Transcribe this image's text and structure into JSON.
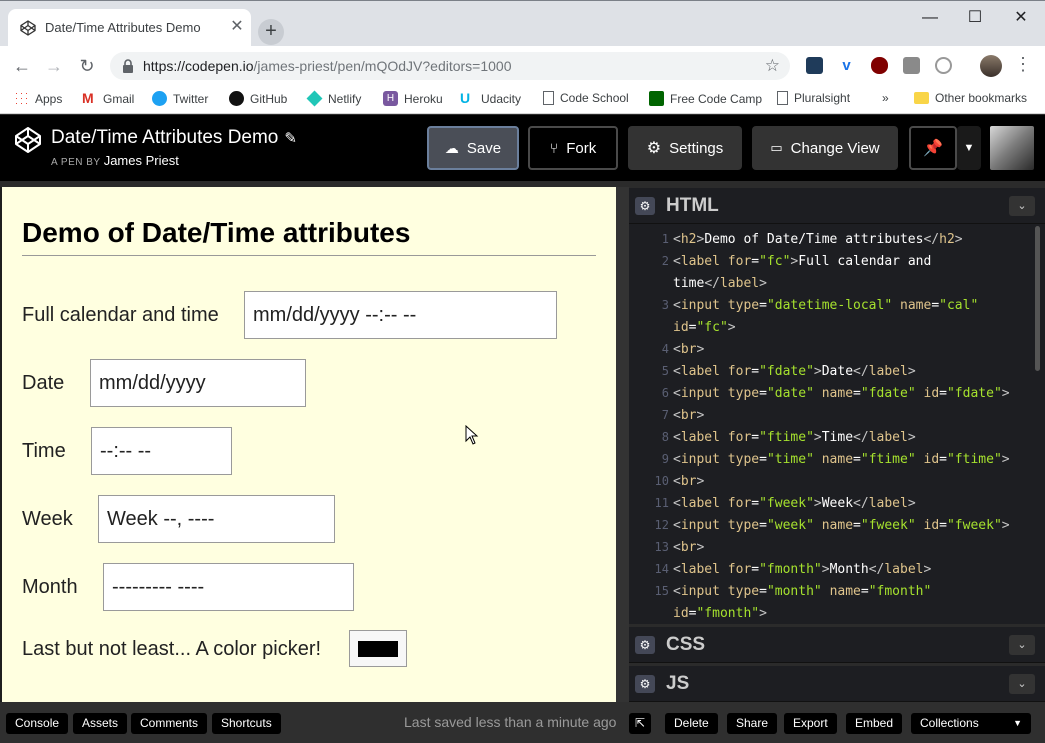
{
  "browser": {
    "tab_title": "Date/Time Attributes Demo",
    "url_host": "https://codepen.io",
    "url_path": "/james-priest/pen/mQOdJV?editors=1000",
    "bookmarks": [
      "Apps",
      "Gmail",
      "Twitter",
      "GitHub",
      "Netlify",
      "Heroku",
      "Udacity",
      "Code School",
      "Free Code Camp",
      "Pluralsight"
    ],
    "more_bookmarks": "»",
    "other_bookmarks": "Other bookmarks"
  },
  "header": {
    "title": "Date/Time Attributes Demo",
    "by_prefix": "A PEN BY",
    "author": "James Priest",
    "save_label": "Save",
    "fork_label": "Fork",
    "settings_label": "Settings",
    "change_view_label": "Change View"
  },
  "result": {
    "heading": "Demo of Date/Time attributes",
    "fields": [
      {
        "label": "Full calendar and time",
        "value": "mm/dd/yyyy --:-- --"
      },
      {
        "label": "Date",
        "value": "mm/dd/yyyy"
      },
      {
        "label": "Time",
        "value": "--:-- --"
      },
      {
        "label": "Week",
        "value": "Week --, ----"
      },
      {
        "label": "Month",
        "value": "--------- ----"
      }
    ],
    "color_label": "Last but not least... A color picker!",
    "color_value": "#000000"
  },
  "editors": {
    "html_title": "HTML",
    "css_title": "CSS",
    "js_title": "JS",
    "line_numbers": [
      "1",
      "2",
      "",
      "3",
      "",
      "4",
      "5",
      "6",
      "7",
      "8",
      "9",
      "10",
      "11",
      "12",
      "13",
      "14",
      "15",
      ""
    ]
  },
  "footer": {
    "console": "Console",
    "assets": "Assets",
    "comments": "Comments",
    "shortcuts": "Shortcuts",
    "saved_status": "Last saved less than a minute ago",
    "delete": "Delete",
    "share": "Share",
    "export": "Export",
    "embed": "Embed",
    "collections": "Collections"
  }
}
